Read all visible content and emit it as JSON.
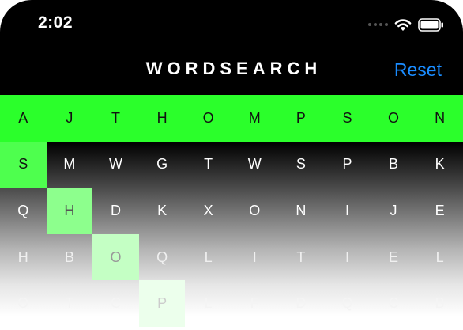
{
  "status_bar": {
    "time": "2:02",
    "icons": [
      "signal-dots-icon",
      "wifi-icon",
      "battery-icon"
    ]
  },
  "nav": {
    "title": "WORDSEARCH",
    "reset_label": "Reset"
  },
  "colors": {
    "highlight": "#2bff2b",
    "accent": "#1a8cff",
    "background": "#000000"
  },
  "grid": {
    "rows": [
      [
        "A",
        "J",
        "T",
        "H",
        "O",
        "M",
        "P",
        "S",
        "O",
        "N"
      ],
      [
        "S",
        "M",
        "W",
        "G",
        "T",
        "W",
        "S",
        "P",
        "B",
        "K"
      ],
      [
        "Q",
        "H",
        "D",
        "K",
        "X",
        "O",
        "N",
        "I",
        "J",
        "E"
      ],
      [
        "H",
        "B",
        "O",
        "Q",
        "L",
        "I",
        "T",
        "I",
        "E",
        "L"
      ],
      [
        "O",
        "T",
        "C",
        "P",
        "L",
        "F",
        "D",
        "Q",
        "C",
        "B"
      ]
    ]
  }
}
